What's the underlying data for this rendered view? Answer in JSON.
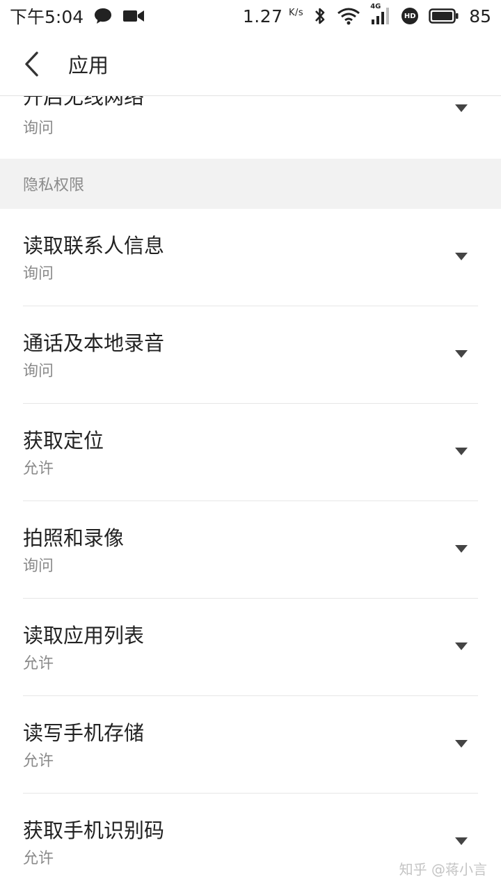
{
  "status_bar": {
    "time": "下午5:04",
    "speed_value": "1.27",
    "speed_unit": "K/s",
    "network": "4G",
    "hd_badge": "HD",
    "battery": "85",
    "icons": [
      "chat-bubble-icon",
      "video-camera-icon",
      "bluetooth-icon",
      "wifi-icon",
      "cellular-signal-icon",
      "hd-icon",
      "battery-icon"
    ]
  },
  "app_bar": {
    "back_icon": "chevron-left-icon",
    "title": "应用"
  },
  "partial_item": {
    "title": "开启无线网络",
    "value": "询问"
  },
  "section": {
    "title": "隐私权限"
  },
  "permissions": [
    {
      "title": "读取联系人信息",
      "value": "询问"
    },
    {
      "title": "通话及本地录音",
      "value": "询问"
    },
    {
      "title": "获取定位",
      "value": "允许"
    },
    {
      "title": "拍照和录像",
      "value": "询问"
    },
    {
      "title": "读取应用列表",
      "value": "允许"
    },
    {
      "title": "读写手机存储",
      "value": "允许"
    },
    {
      "title": "获取手机识别码",
      "value": "允许"
    }
  ],
  "watermark": "知乎 @蒋小言",
  "colors": {
    "text_primary": "#222222",
    "text_secondary": "#8a8a8a",
    "section_bg": "#f2f2f2",
    "divider": "#e6e6e6",
    "arrow": "#444444"
  }
}
